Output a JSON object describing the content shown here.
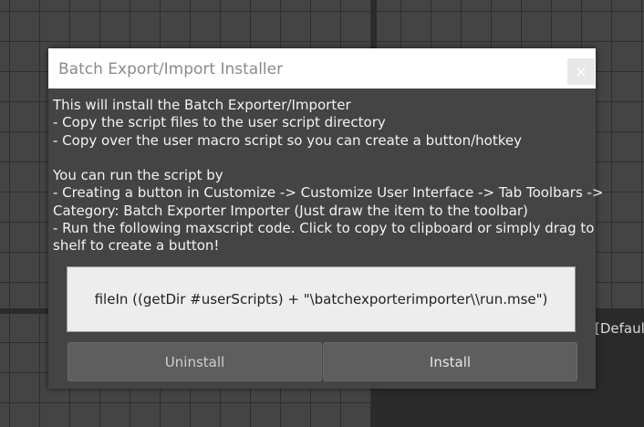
{
  "viewport": {
    "label": "[Defaul"
  },
  "dialog": {
    "title": "Batch Export/Import Installer",
    "close_symbol": "×",
    "body_lines": [
      "This will install the Batch Exporter/Importer",
      "- Copy the script files to the user script directory",
      "- Copy over the user macro script so you can create a button/hotkey",
      "",
      "You can run the script by",
      "- Creating a button in Customize -> Customize User Interface -> Tab Toolbars ->",
      "Category: Batch Exporter Importer (Just draw the item to the toolbar)",
      "- Run the following maxscript code. Click to copy to clipboard or simply drag to",
      "shelf to create a button!"
    ],
    "code_snippet": "fileIn ((getDir #userScripts) + \"\\batchexporterimporter\\\\run.mse\")",
    "buttons": {
      "uninstall": "Uninstall",
      "install": "Install"
    }
  },
  "colors": {
    "dialog_bg": "#444444",
    "titlebar_bg": "#ffffff",
    "button_bg": "#5e5e5e",
    "code_bg": "#ededed"
  }
}
